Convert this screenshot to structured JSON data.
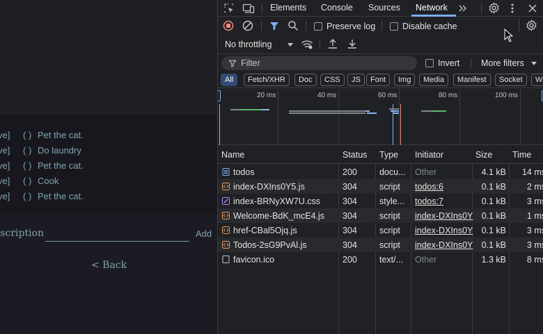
{
  "app": {
    "todos": [
      {
        "remove": "ve]",
        "check": "( )",
        "text": "Pet the cat."
      },
      {
        "remove": "ve]",
        "check": "( )",
        "text": "Do laundry"
      },
      {
        "remove": "ve]",
        "check": "( )",
        "text": "Pet the cat."
      },
      {
        "remove": "ve]",
        "check": "( )",
        "text": "Cook"
      },
      {
        "remove": "ve]",
        "check": "( )",
        "text": "Pet the cat."
      }
    ],
    "description_label": "escription",
    "add_label": "Add",
    "back_label": "< Back"
  },
  "devtools": {
    "tabs": [
      "Elements",
      "Console",
      "Sources",
      "Network"
    ],
    "active_tab": "Network",
    "toolbar": {
      "preserve_log": "Preserve log",
      "disable_cache": "Disable cache",
      "throttling": "No throttling"
    },
    "filter": {
      "placeholder": "Filter",
      "invert": "Invert",
      "more_filters": "More filters"
    },
    "type_filters": [
      "All",
      "Fetch/XHR",
      "Doc",
      "CSS",
      "JS",
      "Font",
      "Img",
      "Media",
      "Manifest",
      "Socket",
      "W"
    ],
    "timeline_ticks": [
      "20 ms",
      "40 ms",
      "60 ms",
      "80 ms",
      "100 ms"
    ],
    "columns": [
      "Name",
      "Status",
      "Type",
      "Initiator",
      "Size",
      "Time"
    ],
    "requests": [
      {
        "name": "todos",
        "status": "200",
        "type": "docu...",
        "initiator": "Other",
        "size": "4.1 kB",
        "time": "14 ms",
        "icon": "document-icon"
      },
      {
        "name": "index-DXIns0Y5.js",
        "status": "304",
        "type": "script",
        "initiator": "todos:6",
        "size": "0.1 kB",
        "time": "2 ms",
        "icon": "script-icon"
      },
      {
        "name": "index-BRNyXW7U.css",
        "status": "304",
        "type": "style...",
        "initiator": "todos:7",
        "size": "0.1 kB",
        "time": "3 ms",
        "icon": "stylesheet-icon"
      },
      {
        "name": "Welcome-BdK_mcE4.js",
        "status": "304",
        "type": "script",
        "initiator": "index-DXIns0Y",
        "size": "0.1 kB",
        "time": "1 ms",
        "icon": "script-icon"
      },
      {
        "name": "href-CBal5Ojq.js",
        "status": "304",
        "type": "script",
        "initiator": "index-DXIns0Y",
        "size": "0.1 kB",
        "time": "3 ms",
        "icon": "script-icon"
      },
      {
        "name": "Todos-2sG9PvAl.js",
        "status": "304",
        "type": "script",
        "initiator": "index-DXIns0Y",
        "size": "0.1 kB",
        "time": "3 ms",
        "icon": "script-icon"
      },
      {
        "name": "favicon.ico",
        "status": "200",
        "type": "text/...",
        "initiator": "Other",
        "size": "1.3 kB",
        "time": "8 ms",
        "icon": "file-icon"
      }
    ]
  },
  "colors": {
    "accent": "#7cacf8",
    "record": "#f28b82",
    "script": "#e8a06a",
    "stylesheet": "#c58af9",
    "document": "#8ab4f8",
    "app_text": "#7fa6b0"
  }
}
